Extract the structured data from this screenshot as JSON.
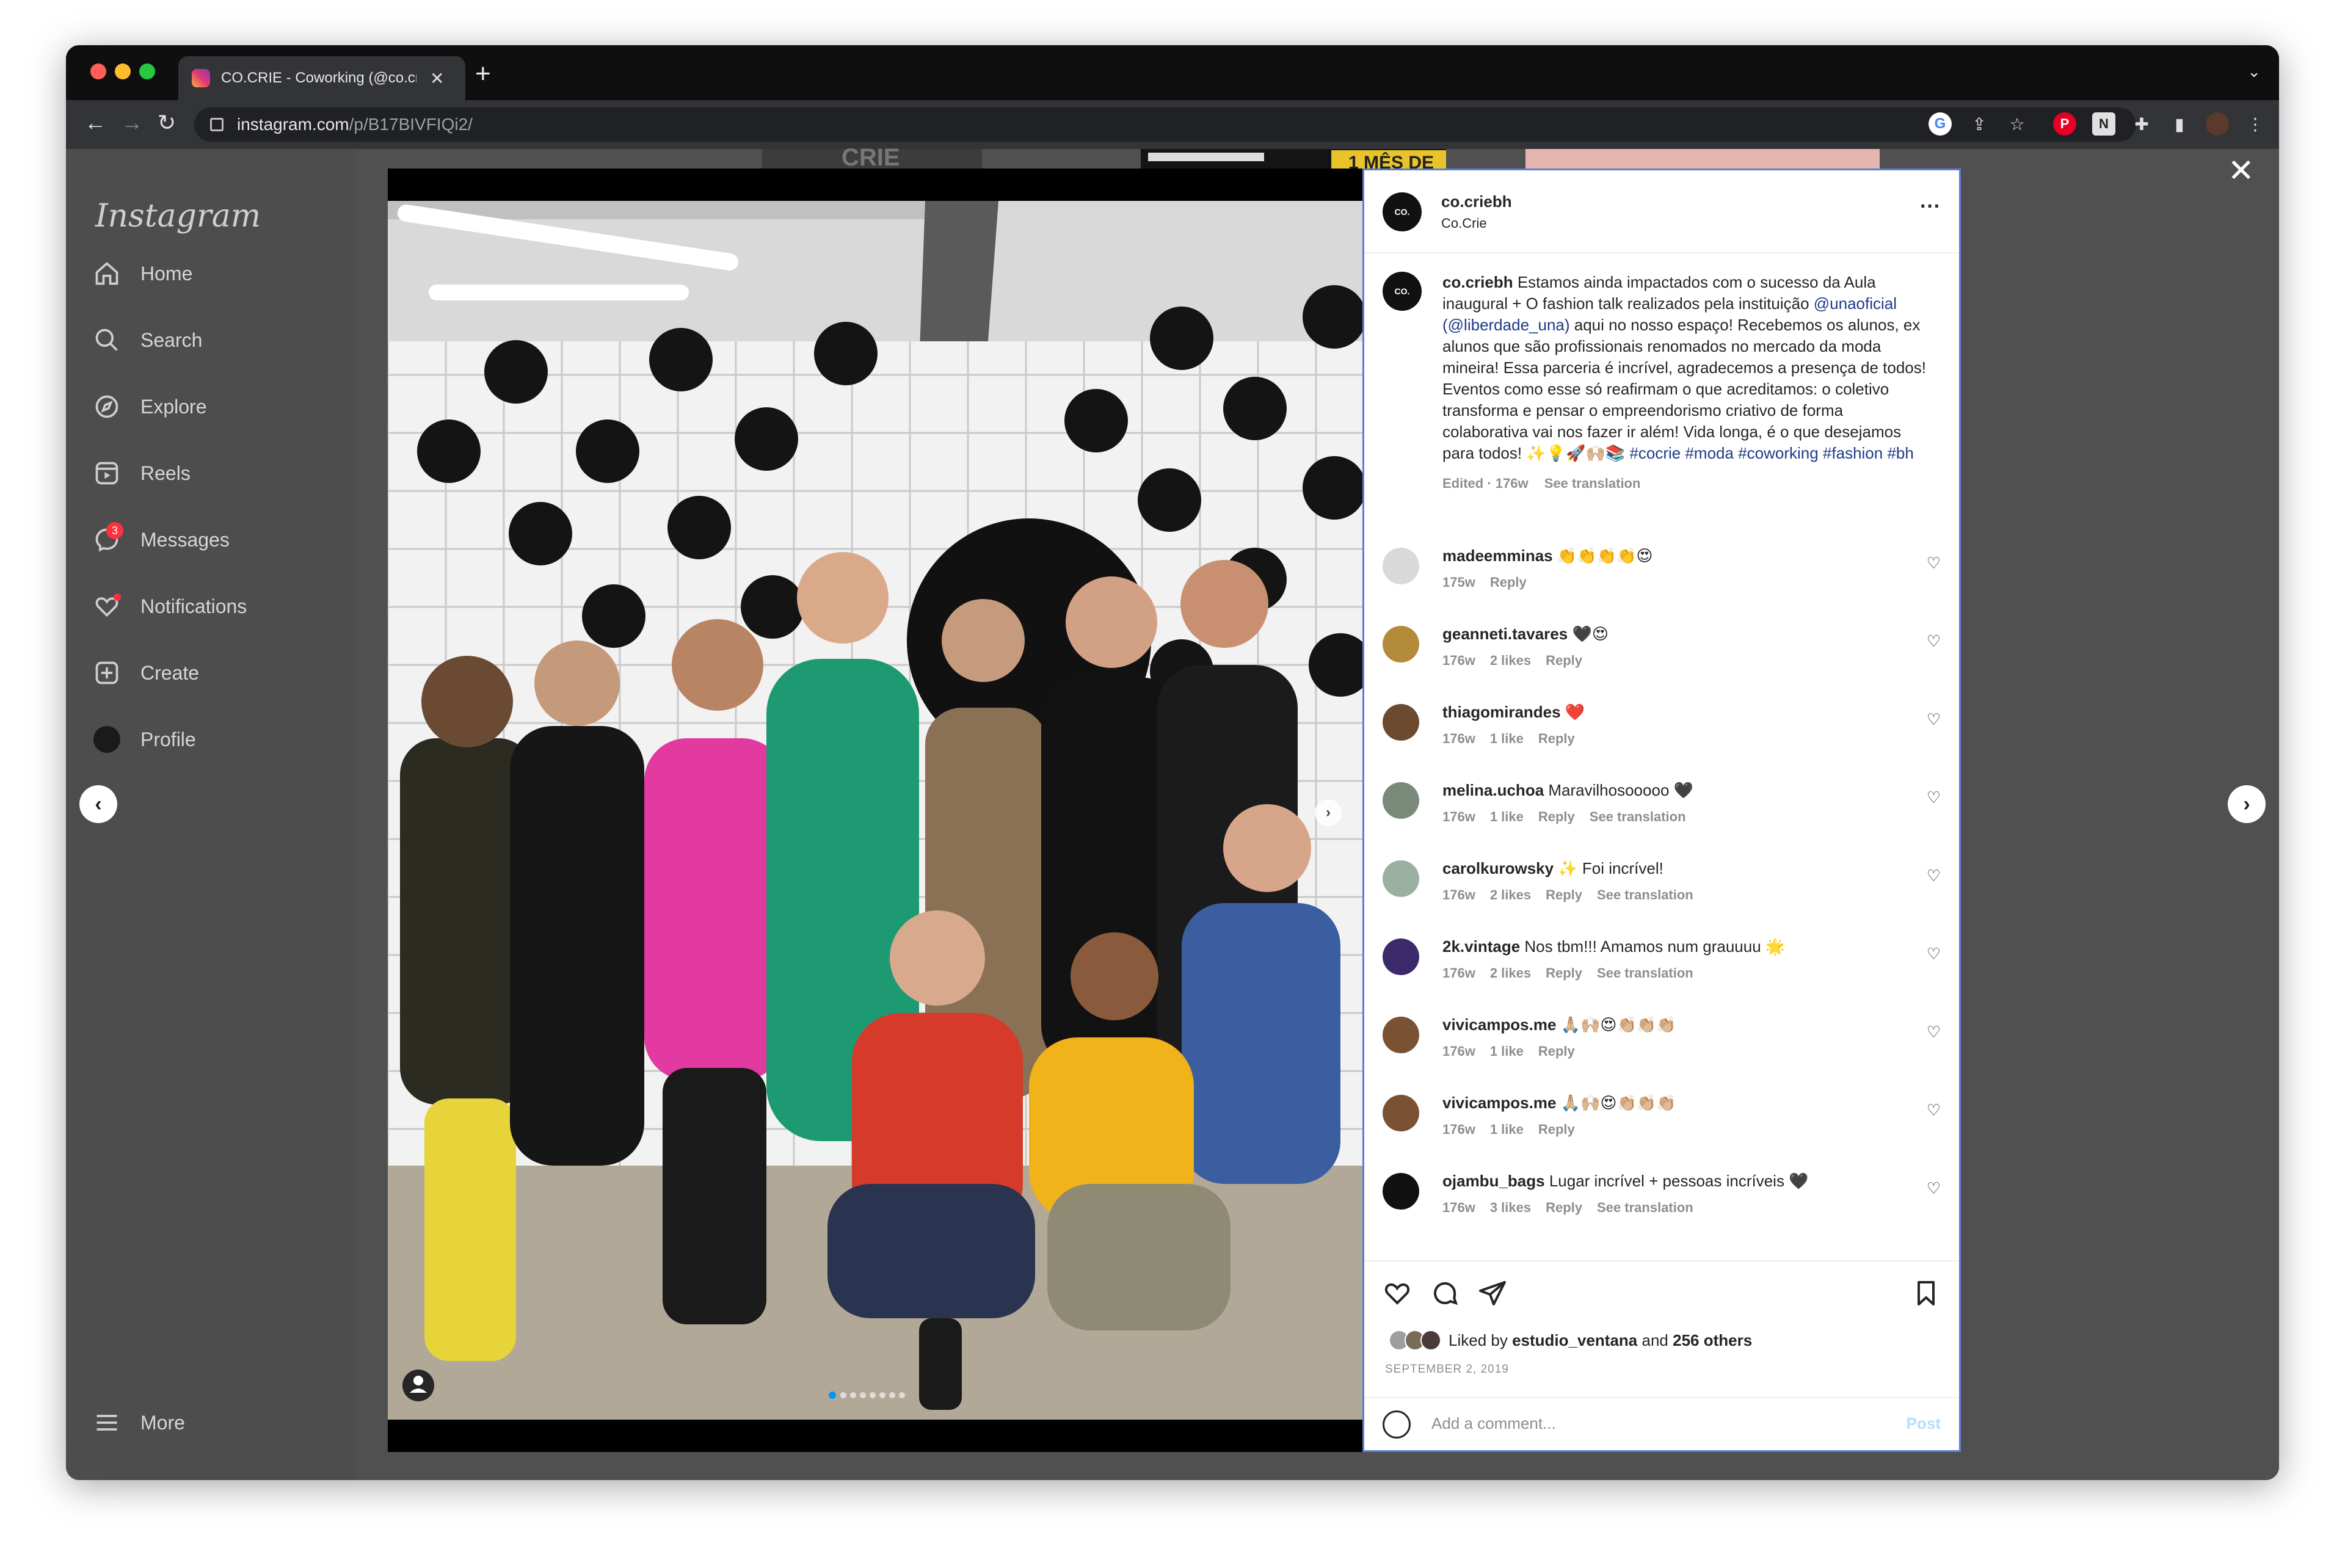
{
  "browser": {
    "tab_title": "CO.CRIE - Coworking (@co.crie",
    "tab_close": "✕",
    "new_tab": "+",
    "url_host": "instagram.com",
    "url_path": "/p/B17BIVFIQi2/"
  },
  "sidebar": {
    "logo": "Instagram",
    "items": [
      {
        "label": "Home",
        "icon": "home-icon"
      },
      {
        "label": "Search",
        "icon": "search-icon"
      },
      {
        "label": "Explore",
        "icon": "compass-icon"
      },
      {
        "label": "Reels",
        "icon": "reels-icon"
      },
      {
        "label": "Messages",
        "icon": "messenger-icon",
        "badge": "3"
      },
      {
        "label": "Notifications",
        "icon": "heart-icon"
      },
      {
        "label": "Create",
        "icon": "plus-square-icon"
      },
      {
        "label": "Profile",
        "icon": "avatar"
      },
      {
        "label": "More",
        "icon": "hamburger-icon"
      }
    ]
  },
  "post": {
    "author": "co.criebh",
    "author_subtitle": "Co.Crie",
    "more": "···",
    "caption_user": "co.criebh",
    "caption_text_1": "Estamos ainda impactados com o sucesso da Aula inaugural + O fashion talk realizados pela instituição",
    "caption_mention_1": "@unaoficial",
    "caption_mention_2": "(@liberdade_una)",
    "caption_text_2": "aqui no nosso espaço! Recebemos os alunos, ex alunos que são profissionais renomados no mercado da moda mineira! Essa parceria é incrível, agradecemos a presença de todos! Eventos como esse só reafirmam o que acreditamos: o coletivo transforma e pensar o empreendorismo criativo de forma colaborativa vai nos fazer ir além! Vida longa, é o que desejamos para todos!",
    "caption_emojis": "✨💡🚀🙌🏼📚",
    "caption_hashtags": "#cocrie #moda #coworking #fashion #bh",
    "edited": "Edited · 176w",
    "see_translation": "See translation",
    "liked_by_prefix": "Liked by",
    "liked_by_user": "estudio_ventana",
    "liked_by_and": "and",
    "liked_by_others": "256 others",
    "date": "SEPTEMBER 2, 2019",
    "add_comment_placeholder": "Add a comment...",
    "post_button": "Post"
  },
  "comments": [
    {
      "user": "madeemminas",
      "text": "👏👏👏👏😍",
      "time": "175w",
      "likes": "",
      "reply": "Reply",
      "translate": "",
      "color": "#d9d9d9"
    },
    {
      "user": "geanneti.tavares",
      "text": "🖤😍",
      "time": "176w",
      "likes": "2 likes",
      "reply": "Reply",
      "translate": "",
      "color": "#b38b3a"
    },
    {
      "user": "thiagomirandes",
      "text": "❤️",
      "time": "176w",
      "likes": "1 like",
      "reply": "Reply",
      "translate": "",
      "color": "#6b4a2f"
    },
    {
      "user": "melina.uchoa",
      "text": "Maravilhosooooo 🖤",
      "time": "176w",
      "likes": "1 like",
      "reply": "Reply",
      "translate": "See translation",
      "color": "#7a8a7a"
    },
    {
      "user": "carolkurowsky",
      "text": "✨ Foi incrível!",
      "time": "176w",
      "likes": "2 likes",
      "reply": "Reply",
      "translate": "See translation",
      "color": "#9bb0a0"
    },
    {
      "user": "2k.vintage",
      "text": "Nos tbm!!! Amamos num grauuuu 🌟",
      "time": "176w",
      "likes": "2 likes",
      "reply": "Reply",
      "translate": "See translation",
      "color": "#3b2a6b"
    },
    {
      "user": "vivicampos.me",
      "text": "🙏🏼🙌🏼😍👏🏼👏🏼👏🏼",
      "time": "176w",
      "likes": "1 like",
      "reply": "Reply",
      "translate": "",
      "color": "#7a5233"
    },
    {
      "user": "vivicampos.me",
      "text": "🙏🏼🙌🏼😍👏🏼👏🏼👏🏼",
      "time": "176w",
      "likes": "1 like",
      "reply": "Reply",
      "translate": "",
      "color": "#7a5233"
    },
    {
      "user": "ojambu_bags",
      "text": "Lugar incrível + pessoas incríveis 🖤",
      "time": "176w",
      "likes": "3 likes",
      "reply": "Reply",
      "translate": "See translation",
      "color": "#111111"
    }
  ],
  "background_snippets": {
    "crie": "CRIE",
    "mes": "1 MÊS DE"
  }
}
